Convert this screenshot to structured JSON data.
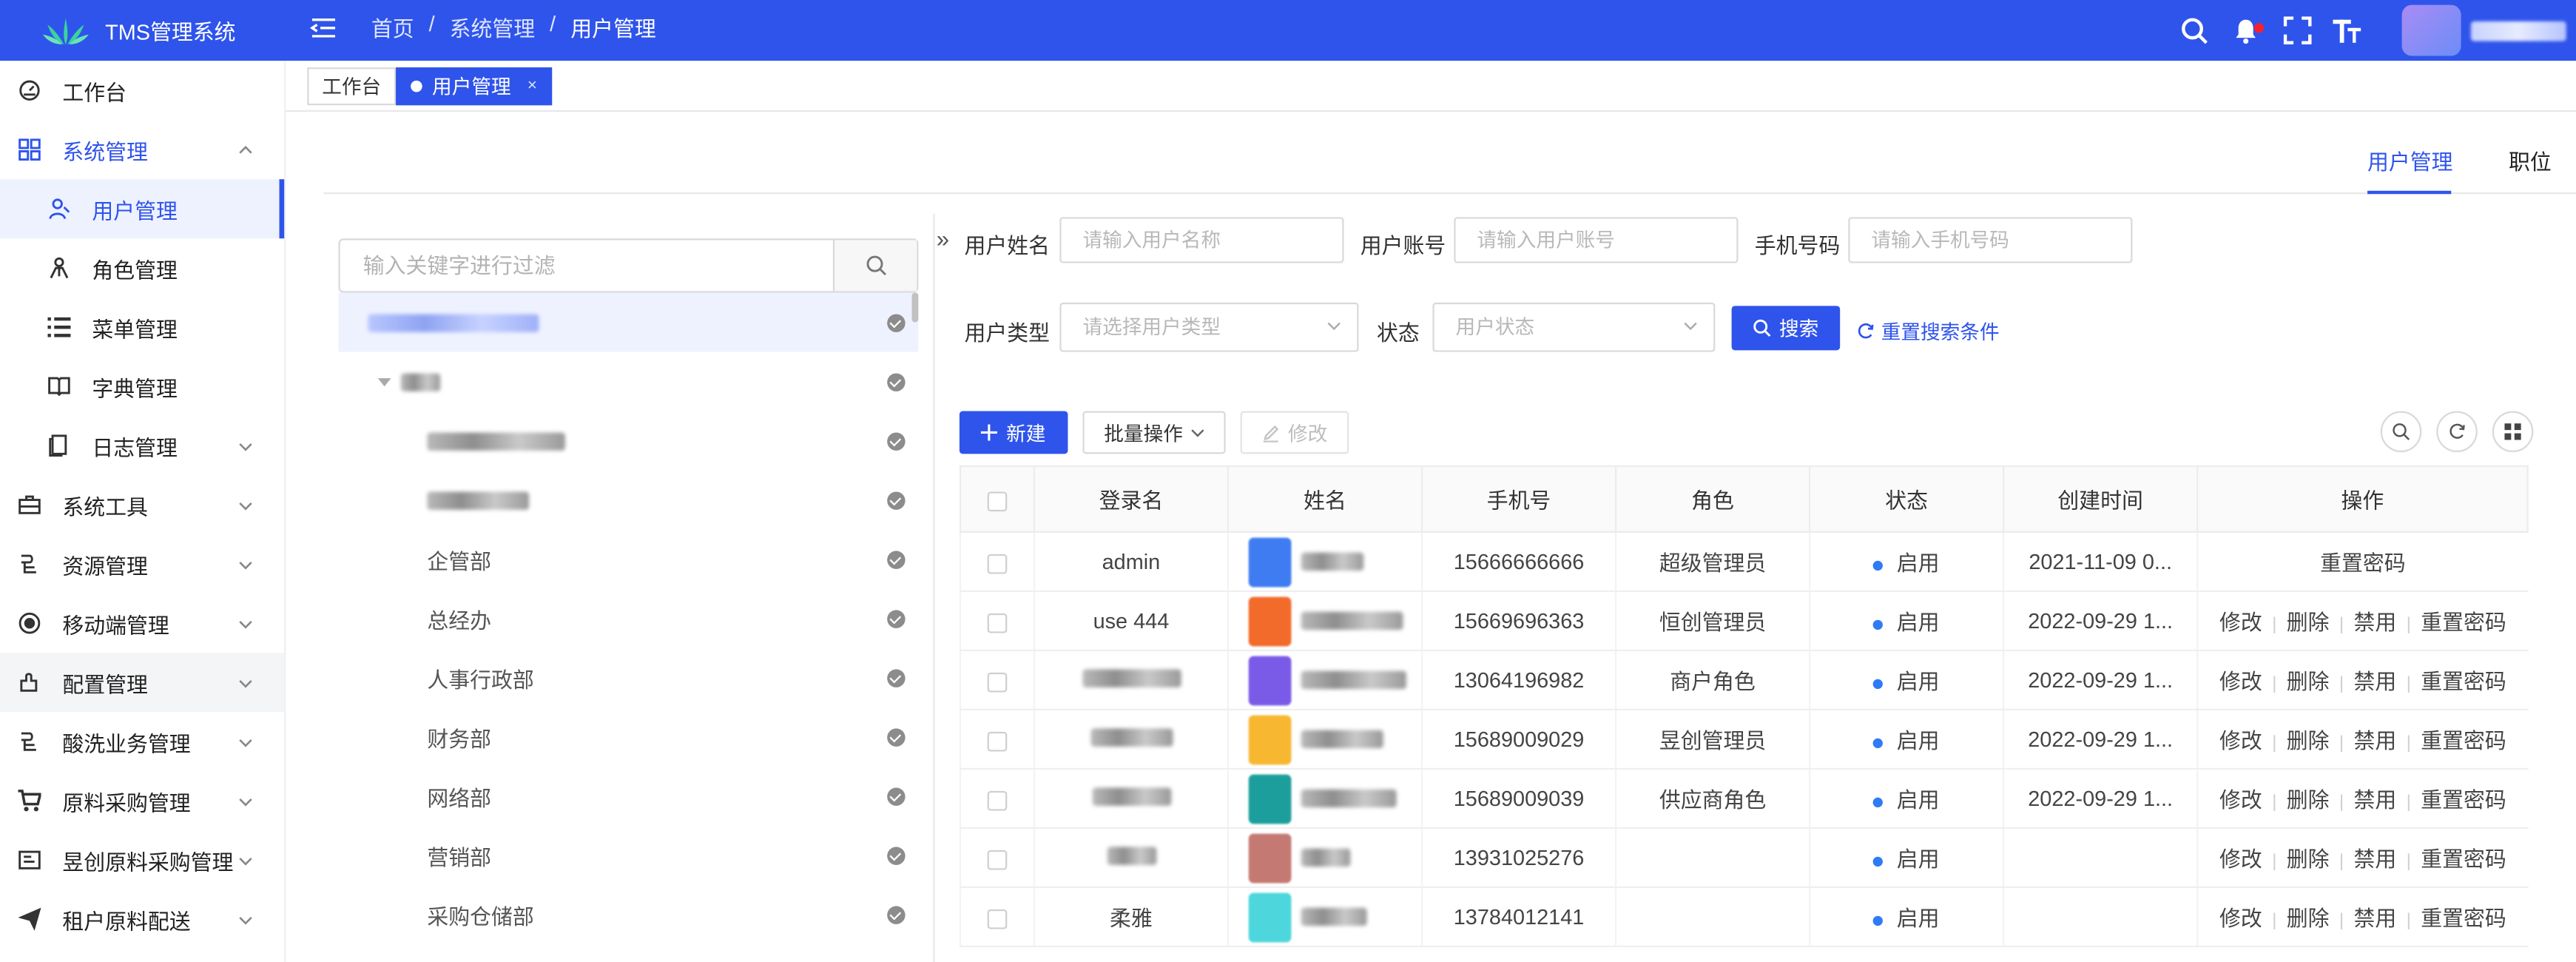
{
  "app": {
    "title": "TMS管理系统"
  },
  "breadcrumb": [
    "首页",
    "系统管理",
    "用户管理"
  ],
  "sidebar": {
    "items": [
      {
        "label": "工作台",
        "icon": "dashboard-icon",
        "level": 0
      },
      {
        "label": "系统管理",
        "icon": "grid-icon",
        "level": 0,
        "state": "open",
        "expand": "up"
      },
      {
        "label": "用户管理",
        "icon": "user-icon",
        "level": 1,
        "state": "active"
      },
      {
        "label": "角色管理",
        "icon": "role-icon",
        "level": 1
      },
      {
        "label": "菜单管理",
        "icon": "list-icon",
        "level": 1
      },
      {
        "label": "字典管理",
        "icon": "book-icon",
        "level": 1
      },
      {
        "label": "日志管理",
        "icon": "file-icon",
        "level": 1,
        "expand": "down"
      },
      {
        "label": "系统工具",
        "icon": "toolbox-icon",
        "level": 0,
        "expand": "down"
      },
      {
        "label": "资源管理",
        "icon": "resource-icon",
        "level": 0,
        "expand": "down"
      },
      {
        "label": "移动端管理",
        "icon": "mobile-icon",
        "level": 0,
        "expand": "down"
      },
      {
        "label": "配置管理",
        "icon": "config-icon",
        "level": 0,
        "expand": "down",
        "state": "hover"
      },
      {
        "label": "酸洗业务管理",
        "icon": "business-icon",
        "level": 0,
        "expand": "down"
      },
      {
        "label": "原料采购管理",
        "icon": "cart-icon",
        "level": 0,
        "expand": "down"
      },
      {
        "label": "昱创原料采购管理",
        "icon": "purchase-icon",
        "level": 0,
        "expand": "down"
      },
      {
        "label": "租户原料配送",
        "icon": "send-icon",
        "level": 0,
        "expand": "down"
      }
    ]
  },
  "tabs": [
    {
      "label": "工作台",
      "active": false
    },
    {
      "label": "用户管理",
      "active": true,
      "close": "×"
    }
  ],
  "right_tabs": [
    {
      "label": "用户管理",
      "active": true
    },
    {
      "label": "职位",
      "active": false
    }
  ],
  "tree": {
    "placeholder": "输入关键字进行过滤",
    "nodes": [
      {
        "label": "",
        "indent": 0,
        "blurred": true,
        "selected": true
      },
      {
        "label": "",
        "indent": 1,
        "blurred": true,
        "caret": true
      },
      {
        "label": "",
        "indent": 2,
        "blurred": true
      },
      {
        "label": "",
        "indent": 2,
        "blurred": true
      },
      {
        "label": "企管部",
        "indent": 2
      },
      {
        "label": "总经办",
        "indent": 2
      },
      {
        "label": "人事行政部",
        "indent": 2
      },
      {
        "label": "财务部",
        "indent": 2
      },
      {
        "label": "网络部",
        "indent": 2
      },
      {
        "label": "营销部",
        "indent": 2
      },
      {
        "label": "采购仓储部",
        "indent": 2
      }
    ]
  },
  "filters": {
    "username_label": "用户姓名",
    "username_placeholder": "请输入用户名称",
    "account_label": "用户账号",
    "account_placeholder": "请输入用户账号",
    "phone_label": "手机号码",
    "phone_placeholder": "请输入手机号码",
    "type_label": "用户类型",
    "type_placeholder": "请选择用户类型",
    "status_label": "状态",
    "status_placeholder": "用户状态",
    "search_label": "搜索",
    "reset_label": "重置搜索条件"
  },
  "toolbar": {
    "new_label": "新建",
    "batch_label": "批量操作",
    "edit_label": "修改"
  },
  "table": {
    "columns": [
      "登录名",
      "姓名",
      "手机号",
      "角色",
      "状态",
      "创建时间",
      "操作"
    ],
    "rows": [
      {
        "login": "admin",
        "name": "",
        "avatar_color": "#3f7cf2",
        "phone": "15666666666",
        "role": "超级管理员",
        "status": "启用",
        "created": "2021-11-09 0...",
        "actions": [
          "重置密码"
        ]
      },
      {
        "login": "use 444",
        "name": "",
        "avatar_color": "#f26b2b",
        "phone": "15669696363",
        "role": "恒创管理员",
        "status": "启用",
        "created": "2022-09-29 1...",
        "actions": [
          "修改",
          "删除",
          "禁用",
          "重置密码"
        ]
      },
      {
        "login": "",
        "name": "",
        "avatar_color": "#7a5be8",
        "phone": "13064196982",
        "role": "商户角色",
        "status": "启用",
        "created": "2022-09-29 1...",
        "actions": [
          "修改",
          "删除",
          "禁用",
          "重置密码"
        ]
      },
      {
        "login": "",
        "name": "",
        "avatar_color": "#f7b731",
        "phone": "15689009029",
        "role": "昱创管理员",
        "status": "启用",
        "created": "2022-09-29 1...",
        "actions": [
          "修改",
          "删除",
          "禁用",
          "重置密码"
        ]
      },
      {
        "login": "",
        "name": "",
        "avatar_color": "#1c9f9c",
        "phone": "15689009039",
        "role": "供应商角色",
        "status": "启用",
        "created": "2022-09-29 1...",
        "actions": [
          "修改",
          "删除",
          "禁用",
          "重置密码"
        ]
      },
      {
        "login": "",
        "name": "",
        "avatar_color": "#c47a72",
        "phone": "13931025276",
        "role": "",
        "status": "启用",
        "created": "",
        "actions": [
          "修改",
          "删除",
          "禁用",
          "重置密码"
        ]
      },
      {
        "login": "柔雅",
        "name": "",
        "avatar_color": "#4dd6dc",
        "phone": "13784012141",
        "role": "",
        "status": "启用",
        "created": "",
        "actions": [
          "修改",
          "删除",
          "禁用",
          "重置密码"
        ]
      }
    ]
  },
  "colors": {
    "primary": "#2f54eb",
    "status_dot": "#2f7bf5"
  }
}
